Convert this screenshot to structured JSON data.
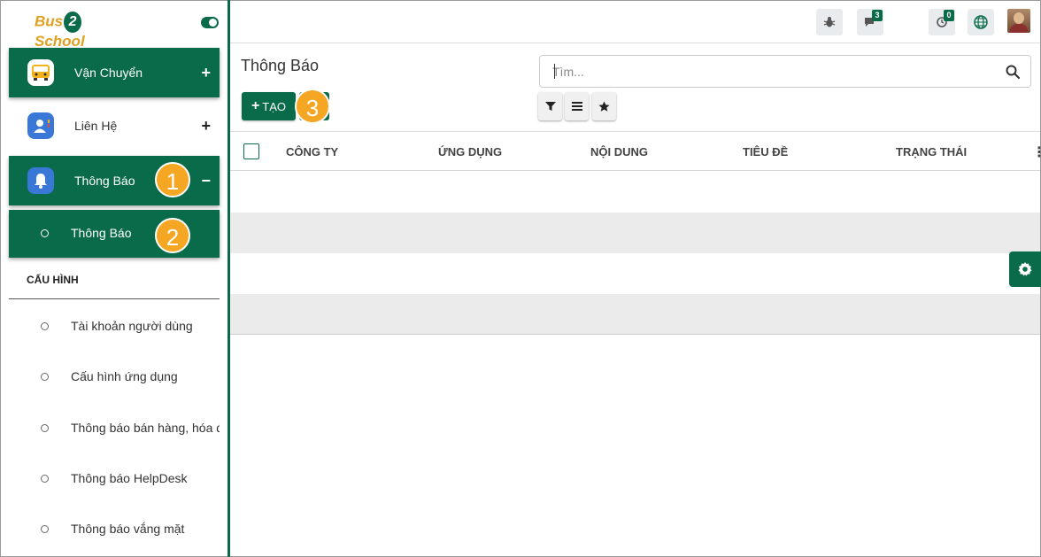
{
  "app": {
    "logo_text": "Bus2School",
    "colors": {
      "primary": "#0a6b4a",
      "accent_badge": "#f5a623"
    }
  },
  "sidebar": {
    "menu": [
      {
        "label": "Vận Chuyển",
        "toggle": "+",
        "active": true,
        "icon": "bus-icon"
      },
      {
        "label": "Liên Hệ",
        "toggle": "+",
        "active": false,
        "icon": "contacts-icon"
      },
      {
        "label": "Thông Báo",
        "toggle": "−",
        "active": true,
        "icon": "bell-icon"
      }
    ],
    "submenu": {
      "label": "Thông Báo"
    },
    "config_section": {
      "title": "CẤU HÌNH",
      "items": [
        {
          "label": "Tài khoản người dùng"
        },
        {
          "label": "Cấu hình ứng dụng"
        },
        {
          "label": "Thông báo bán hàng, hóa đơn"
        },
        {
          "label": "Thông báo HelpDesk"
        },
        {
          "label": "Thông báo vắng mặt"
        }
      ]
    }
  },
  "step_badges": [
    "1",
    "2",
    "3"
  ],
  "topbar": {
    "messages_count": "3",
    "activities_count": "0"
  },
  "control_panel": {
    "title": "Thông Báo",
    "create_label": "TẠO",
    "search_placeholder": "Tìm..."
  },
  "table": {
    "columns": [
      "CÔNG TY",
      "ỨNG DỤNG",
      "NỘI DUNG",
      "TIÊU ĐỀ",
      "TRẠNG THÁI"
    ],
    "rows": []
  }
}
